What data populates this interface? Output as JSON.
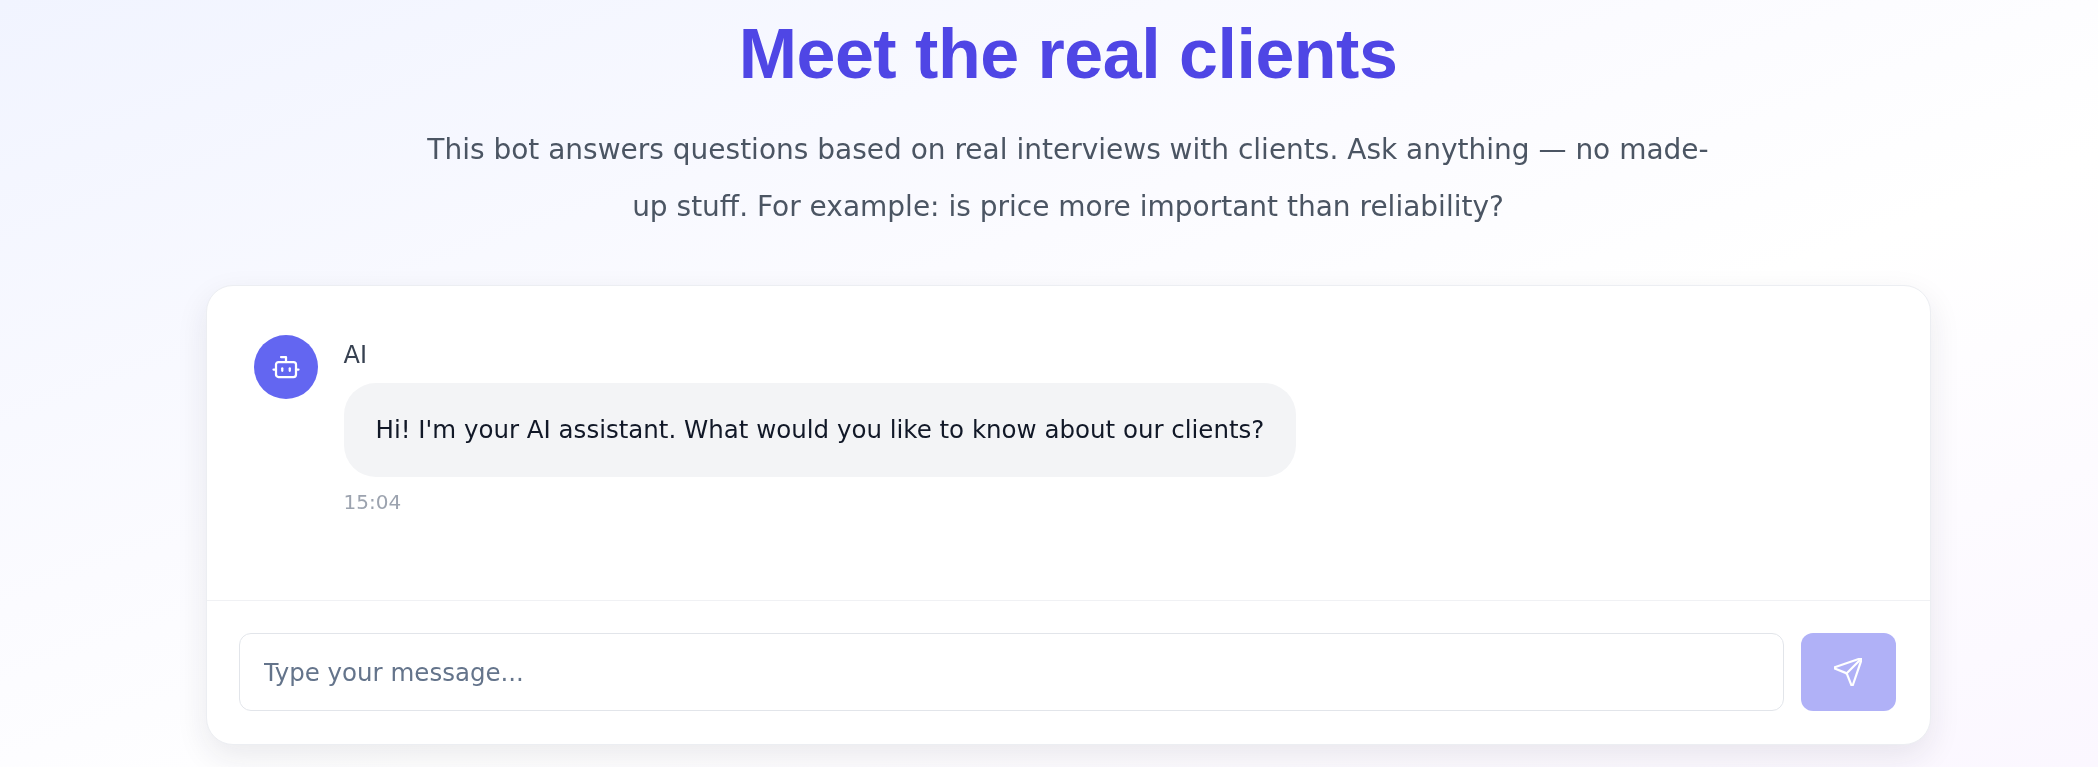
{
  "header": {
    "title": "Meet the real clients",
    "subtitle": "This bot answers questions based on real interviews with clients. Ask anything — no made-up stuff. For example: is price more important than reliability?"
  },
  "chat": {
    "messages": [
      {
        "kind": "bot",
        "sender": "AI",
        "text": "Hi! I'm your AI assistant. What would you like to know about our clients?",
        "time": "15:04"
      }
    ],
    "composer": {
      "placeholder": "Type your message...",
      "send_disabled": true
    }
  }
}
